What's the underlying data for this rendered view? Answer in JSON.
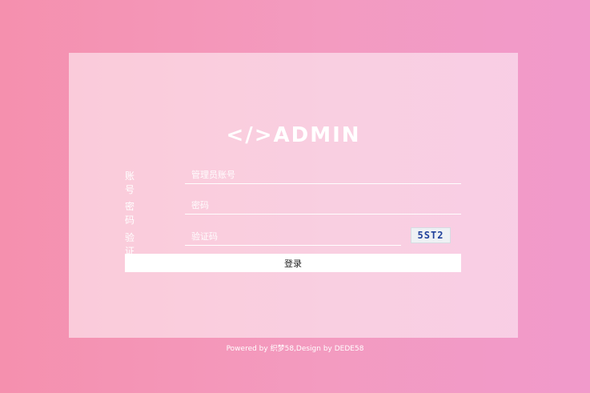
{
  "logo": "</>ADMIN",
  "form": {
    "account_label": "账号",
    "account_placeholder": "管理员账号",
    "password_label": "密码",
    "password_placeholder": "密码",
    "captcha_label": "验证码",
    "captcha_placeholder": "验证码",
    "captcha_text": "5ST2",
    "login_label": "登录"
  },
  "footer": "Powered by 织梦58,Design by DEDE58"
}
